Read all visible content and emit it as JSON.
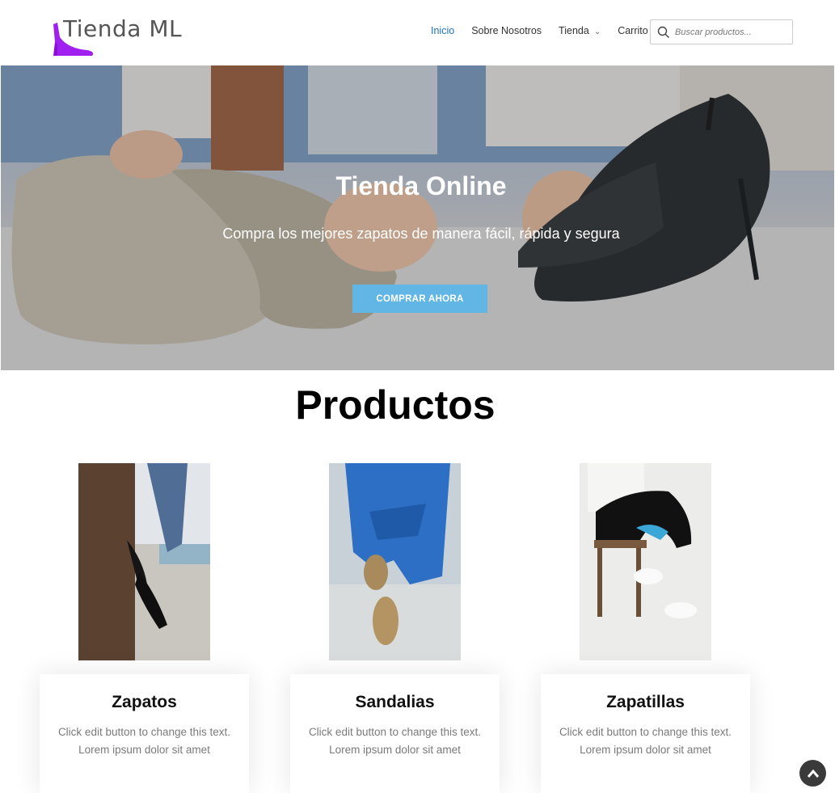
{
  "brand": {
    "name": "Tienda ML",
    "accent": "#a020f0"
  },
  "nav": {
    "items": [
      {
        "label": "Inicio",
        "active": true
      },
      {
        "label": "Sobre Nosotros"
      },
      {
        "label": "Tienda",
        "has_dropdown": true
      },
      {
        "label": "Carrito"
      }
    ],
    "link_color": "#1e73be"
  },
  "search": {
    "placeholder": "Buscar productos..."
  },
  "hero": {
    "title": "Tienda Online",
    "subtitle": "Compra los mejores zapatos de manera fácil, rápida y segura",
    "button_label": "COMPRAR AHORA",
    "button_color": "#61b6e6"
  },
  "products": {
    "title": "Productos",
    "items": [
      {
        "name": "Zapatos",
        "line1": "Click edit button to change this text.",
        "line2": "Lorem ipsum dolor sit amet"
      },
      {
        "name": "Sandalias",
        "line1": "Click edit button to change this text.",
        "line2": "Lorem ipsum dolor sit amet"
      },
      {
        "name": "Zapatillas",
        "line1": "Click edit button to change this text.",
        "line2": "Lorem ipsum dolor sit amet"
      }
    ]
  },
  "icons": {
    "search": "search-icon",
    "scroll_top": "chevron-up-icon",
    "dropdown": "chevron-down-icon"
  }
}
